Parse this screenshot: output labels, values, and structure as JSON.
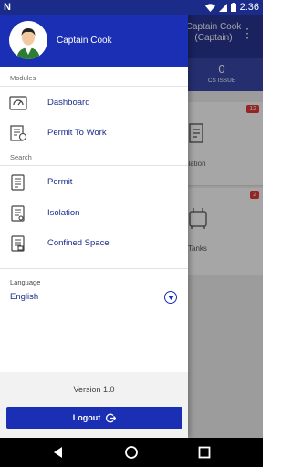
{
  "status_bar": {
    "left_icon": "N",
    "time": "2:36",
    "icons": [
      "wifi-icon",
      "signal-icon",
      "battery-icon"
    ]
  },
  "background": {
    "title": "Captain Cook (Captain)",
    "title_line1": "Captain Cook",
    "title_line2": "(Captain)",
    "cs_issue_count": "0",
    "cs_issue_label": "CS ISSUE",
    "cards": [
      {
        "badge": "12",
        "label": "Isolation",
        "visible_label": "solation"
      },
      {
        "badge": "2",
        "label": "Tanks",
        "visible_label": "Tanks"
      }
    ]
  },
  "drawer": {
    "user_name": "Captain Cook",
    "modules_label": "Modules",
    "modules": [
      {
        "label": "Dashboard",
        "icon": "dashboard-icon"
      },
      {
        "label": "Permit To Work",
        "icon": "permit-to-work-icon"
      }
    ],
    "search_label": "Search",
    "search_items": [
      {
        "label": "Permit",
        "icon": "permit-icon"
      },
      {
        "label": "Isolation",
        "icon": "isolation-icon"
      },
      {
        "label": "Confined Space",
        "icon": "confined-space-icon"
      }
    ],
    "language_label": "Language",
    "language_value": "English",
    "version": "Version 1.0",
    "logout_label": "Logout"
  },
  "colors": {
    "primary": "#1a2fb3",
    "header_dark": "#283593",
    "badge": "#e53935"
  }
}
